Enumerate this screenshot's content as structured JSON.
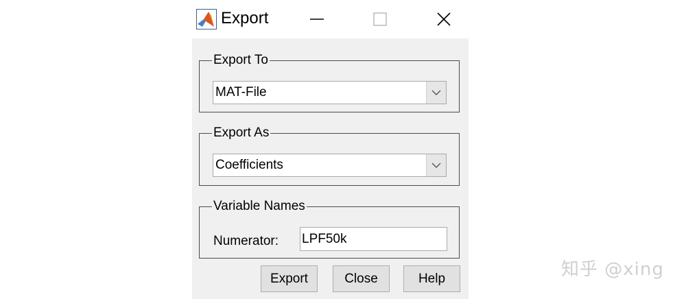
{
  "window": {
    "title": "Export",
    "icon": "matlab-icon",
    "controls": [
      "minimize-icon",
      "maximize-icon",
      "close-icon"
    ]
  },
  "export_to": {
    "legend": "Export To",
    "selected": "MAT-File"
  },
  "export_as": {
    "legend": "Export As",
    "selected": "Coefficients"
  },
  "variable_names": {
    "legend": "Variable Names",
    "numerator_label": "Numerator:",
    "numerator_value": "LPF50k"
  },
  "buttons": {
    "export": "Export",
    "close": "Close",
    "help": "Help"
  },
  "watermark": "知乎 @xing",
  "colors": {
    "dialog_background": "#f0f0f0",
    "button_background": "#e1e1e1",
    "group_border": "#4a4a4a"
  }
}
